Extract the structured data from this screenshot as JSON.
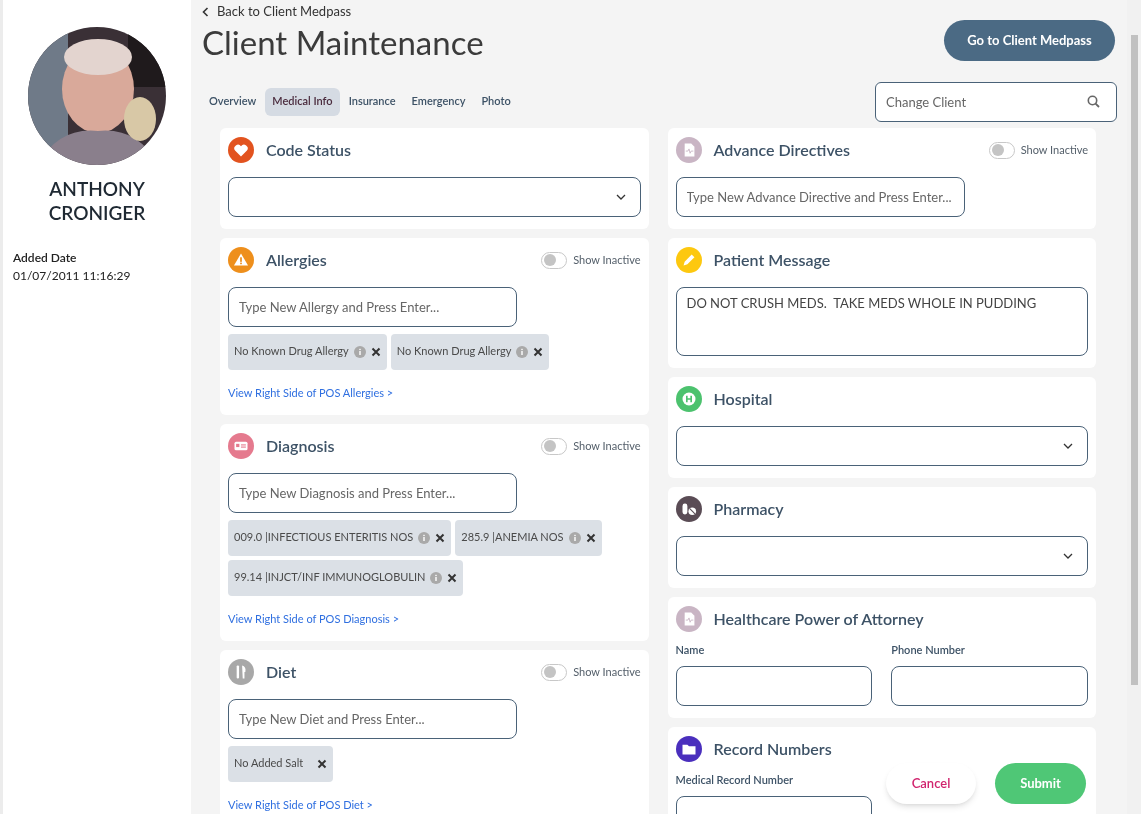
{
  "sidebar": {
    "client_name": "ANTHONY CRONIGER",
    "added_label": "Added Date",
    "added_value": "01/07/2011 11:16:29"
  },
  "header": {
    "back_link": "Back to Client Medpass",
    "title": "Client Maintenance",
    "action_button": "Go to Client Medpass"
  },
  "tabs": [
    {
      "label": "Overview",
      "selected": false
    },
    {
      "label": "Medical Info",
      "selected": true
    },
    {
      "label": "Insurance",
      "selected": false
    },
    {
      "label": "Emergency",
      "selected": false
    },
    {
      "label": "Photo",
      "selected": false
    }
  ],
  "search": {
    "placeholder": "Change Client"
  },
  "left_column": [
    {
      "kind": "select",
      "color": "#e2531f",
      "title": "Code Status"
    },
    {
      "kind": "tags",
      "color": "#ee8f1c",
      "title": "Allergies",
      "toggle": {
        "label": "Show Inactive",
        "on": false
      },
      "placeholder": "Type New Allergy and Press Enter...",
      "tags": [
        {
          "text": "No Known Drug Allergy",
          "info": true
        },
        {
          "text": "No Known Drug Allergy",
          "info": true
        }
      ],
      "link": "View Right Side of POS Allergies >"
    },
    {
      "kind": "tags",
      "color": "#e57a8e",
      "title": "Diagnosis",
      "toggle": {
        "label": "Show Inactive",
        "on": false
      },
      "placeholder": "Type New Diagnosis and Press Enter...",
      "tags": [
        {
          "text": "009.0 |INFECTIOUS ENTERITIS NOS",
          "info": true
        },
        {
          "text": "285.9 |ANEMIA NOS",
          "info": true
        },
        {
          "text": "99.14 |INJCT/INF IMMUNOGLOBULIN",
          "info": true
        }
      ],
      "link": "View Right Side of POS Diagnosis >"
    },
    {
      "kind": "tags",
      "color": "#a8a8a8",
      "title": "Diet",
      "toggle": {
        "label": "Show Inactive",
        "on": false
      },
      "placeholder": "Type New Diet and Press Enter...",
      "tags": [
        {
          "text": "No Added Salt",
          "info": false
        }
      ],
      "link": "View Right Side of POS Diet >"
    }
  ],
  "right_column": [
    {
      "kind": "input",
      "color": "#c9b5c4",
      "title": "Advance Directives",
      "toggle": {
        "label": "Show Inactive",
        "on": false
      },
      "placeholder": "Type New Advance Directive and Press Enter..."
    },
    {
      "kind": "textarea",
      "color": "#fdc80f",
      "title": "Patient Message",
      "value": "DO NOT CRUSH MEDS.  TAKE MEDS WHOLE IN PUDDING"
    },
    {
      "kind": "select",
      "color": "#4cc26e",
      "title": "Hospital"
    },
    {
      "kind": "select",
      "color": "#5a4c55",
      "title": "Pharmacy"
    },
    {
      "kind": "fields",
      "color": "#c9b5c4",
      "title": "Healthcare Power of Attorney",
      "fields": [
        {
          "label": "Name"
        },
        {
          "label": "Phone Number"
        }
      ]
    },
    {
      "kind": "fields",
      "color": "#4a2fbd",
      "title": "Record Numbers",
      "fields": [
        {
          "label": "Medical Record Number"
        }
      ]
    }
  ],
  "footer": {
    "cancel": "Cancel",
    "submit": "Submit"
  }
}
